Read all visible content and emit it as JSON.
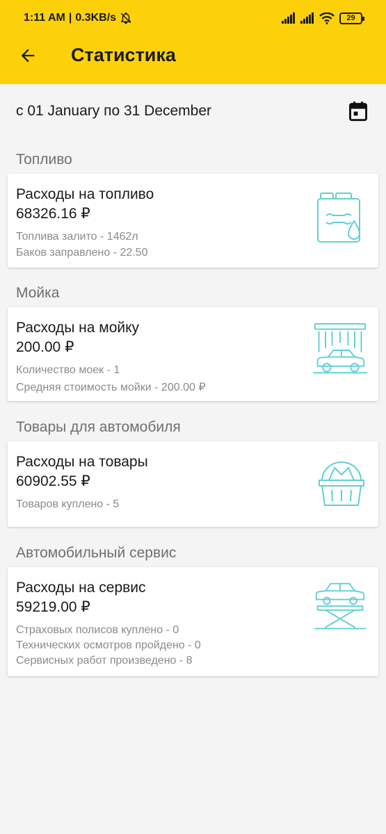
{
  "status_bar": {
    "time": "1:11 AM",
    "network_speed": "0.3KB/s",
    "battery_level": "29",
    "icons": [
      "bell-off-icon",
      "signal-icon",
      "signal-icon",
      "wifi-icon",
      "battery-icon"
    ]
  },
  "header": {
    "title": "Статистика",
    "back_icon": "arrow-left-icon",
    "background_color": "#fdd109"
  },
  "date_range": {
    "text": "с 01 January по 31 December",
    "calendar_icon": "calendar-icon"
  },
  "sections": [
    {
      "title": "Топливо",
      "card_title": "Расходы на топливо",
      "amount": "68326.16 ₽",
      "details": [
        "Топлива залито - 1462л",
        "Баков заправлено - 22.50"
      ],
      "icon": "fuel-canister-icon"
    },
    {
      "title": "Мойка",
      "card_title": "Расходы на мойку",
      "amount": "200.00 ₽",
      "details": [
        "Количество моек - 1",
        "Средняя стоимость мойки - 200.00 ₽"
      ],
      "icon": "car-wash-icon"
    },
    {
      "title": "Товары для автомобиля",
      "card_title": "Расходы на товары",
      "amount": "60902.55 ₽",
      "details": [
        "Товаров куплено - 5"
      ],
      "icon": "shopping-basket-icon"
    },
    {
      "title": "Автомобильный сервис",
      "card_title": "Расходы на сервис",
      "amount": "59219.00 ₽",
      "details": [
        "Страховых полисов куплено - 0",
        "Технических осмотров пройдено - 0",
        "Сервисных работ произведено - 8"
      ],
      "icon": "car-lift-icon"
    }
  ],
  "colors": {
    "accent": "#fdd109",
    "icon_color": "#5fcfd6",
    "background": "#f4f4f4",
    "secondary_text": "#8a8a8a"
  }
}
